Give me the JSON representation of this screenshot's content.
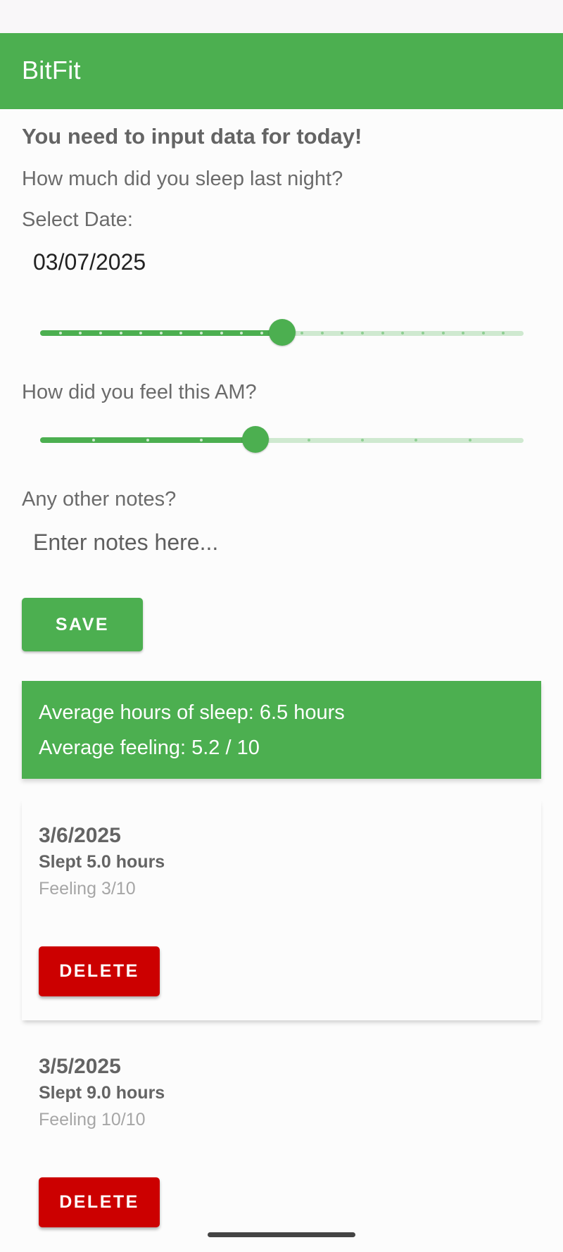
{
  "app": {
    "title": "BitFit"
  },
  "colors": {
    "primary": "#4caf50",
    "track_inactive": "#cfe9d0",
    "danger": "#cc0000"
  },
  "form": {
    "heading": "You need to input data for today!",
    "sleep_question": "How much did you sleep last night?",
    "date_label": "Select Date:",
    "date_value": "03/07/2025",
    "sleep_slider": {
      "fraction": 0.5,
      "steps": 24
    },
    "feel_question": "How did you feel this AM?",
    "feel_slider": {
      "fraction": 0.445,
      "steps": 9
    },
    "notes_label": "Any other notes?",
    "notes_placeholder": "Enter notes here...",
    "notes_value": "",
    "save_label": "SAVE"
  },
  "summary": {
    "avg_sleep": "Average hours of sleep: 6.5 hours",
    "avg_feeling": "Average feeling: 5.2 / 10"
  },
  "entries": [
    {
      "date": "3/6/2025",
      "slept": "Slept 5.0 hours",
      "feeling": "Feeling 3/10",
      "delete_label": "DELETE"
    },
    {
      "date": "3/5/2025",
      "slept": "Slept 9.0 hours",
      "feeling": "Feeling 10/10",
      "delete_label": "DELETE"
    }
  ]
}
